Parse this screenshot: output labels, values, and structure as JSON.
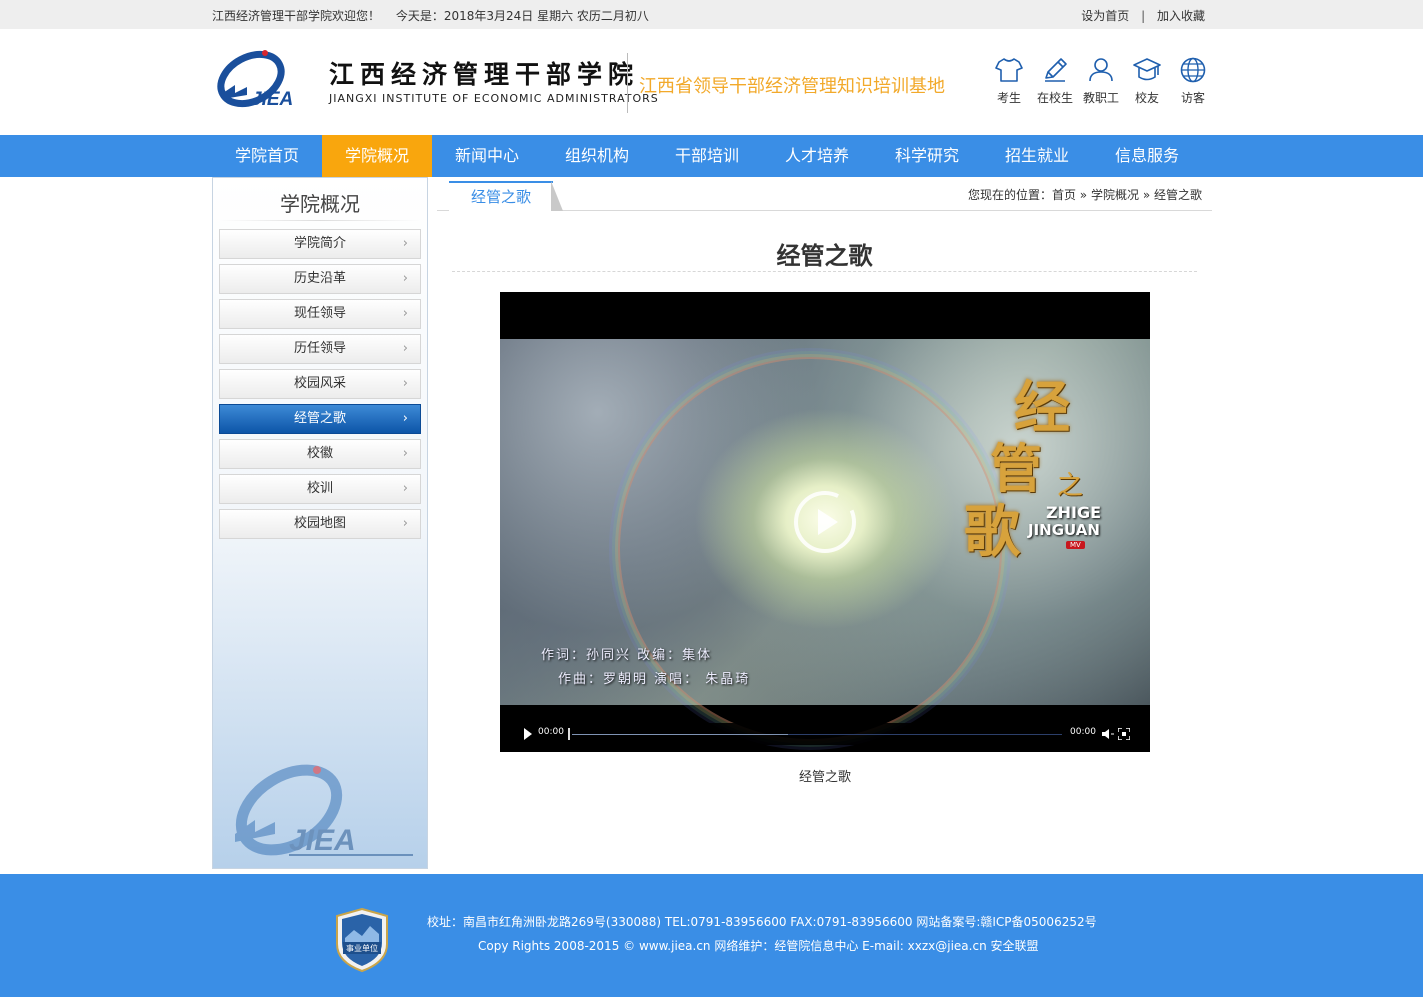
{
  "topbar": {
    "welcome": "江西经济管理干部学院欢迎您！",
    "date": "今天是：2018年3月24日 星期六 农历二月初八",
    "set_home": "设为首页",
    "separator": "|",
    "favorite": "加入收藏"
  },
  "header": {
    "logo_mark": "JIEA",
    "logo_cn": "江西经济管理干部学院",
    "logo_en": "JIANGXI INSTITUTE OF ECONOMIC ADMINISTRATORS",
    "slogan": "江西省领导干部经济管理知识培训基地",
    "quick_links": [
      {
        "label": "考生",
        "icon": "tshirt-icon"
      },
      {
        "label": "在校生",
        "icon": "pencil-icon"
      },
      {
        "label": "教职工",
        "icon": "person-icon"
      },
      {
        "label": "校友",
        "icon": "graduation-cap-icon"
      },
      {
        "label": "访客",
        "icon": "globe-icon"
      }
    ]
  },
  "nav": {
    "items": [
      "学院首页",
      "学院概况",
      "新闻中心",
      "组织机构",
      "干部培训",
      "人才培养",
      "科学研究",
      "招生就业",
      "信息服务"
    ],
    "active": "学院概况"
  },
  "sidebar": {
    "title": "学院概况",
    "items": [
      "学院简介",
      "历史沿革",
      "现任领导",
      "历任领导",
      "校园风采",
      "经管之歌",
      "校徽",
      "校训",
      "校园地图"
    ],
    "active": "经管之歌",
    "chevron": "›",
    "watermark": "JIEA"
  },
  "content": {
    "tab": "经管之歌",
    "breadcrumb": {
      "prefix": "您现在的位置：",
      "home": "首页",
      "sep": "»",
      "section": "学院概况",
      "current": "经管之歌"
    },
    "title": "经管之歌",
    "video": {
      "title_chars": [
        "经",
        "管",
        "歌"
      ],
      "title_zhi": "之",
      "title_en_1": "ZHIGE",
      "title_en_2": "JINGUAN",
      "title_badge": "MV",
      "credit_line_1": "作词：孙同兴  改编：集体",
      "credit_line_2": "作曲：罗朝明  演唱：  朱晶琦",
      "current_time": "00:00",
      "duration": "00:00",
      "buffered_fraction": 0.44
    },
    "caption": "经管之歌"
  },
  "footer": {
    "badge_text": "事业单位",
    "line1": "校址：南昌市红角洲卧龙路269号(330088) TEL:0791-83956600 FAX:0791-83956600 网站备案号:赣ICP备05006252号",
    "line2": "Copy Rights 2008-2015 © www.jiea.cn 网络维护：经管院信息中心 E-mail: xxzx@jiea.cn 安全联盟"
  },
  "colors": {
    "primary_blue": "#3a8ee6",
    "nav_active": "#f9a60d",
    "slogan": "#f2a92a",
    "sidebar_active": "#0d55a8"
  }
}
